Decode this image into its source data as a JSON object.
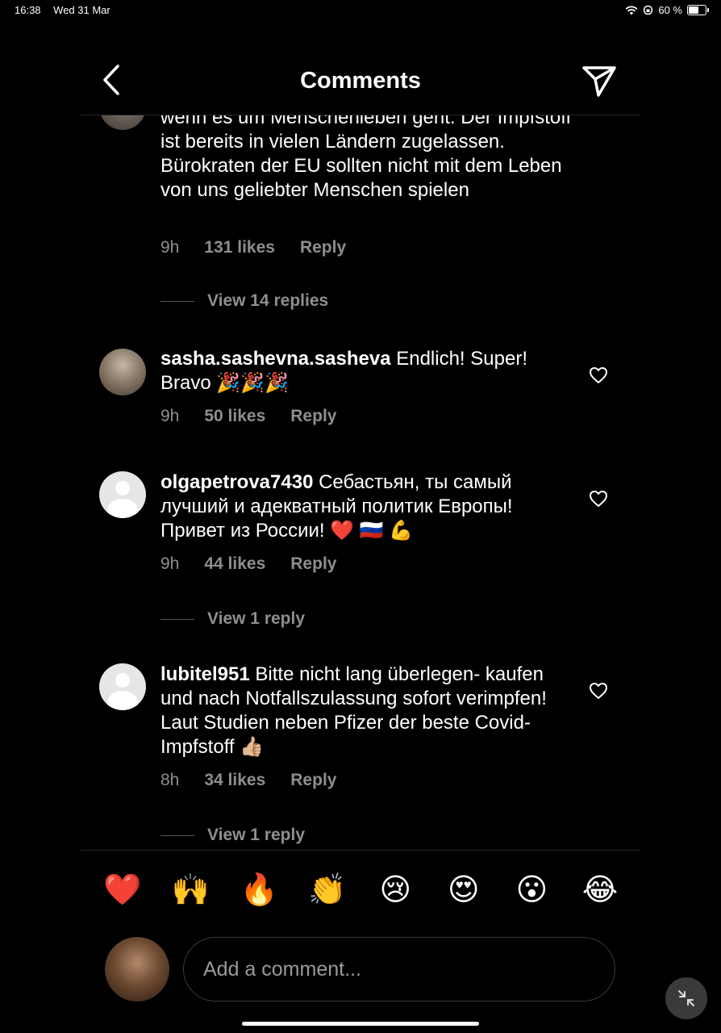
{
  "status_bar": {
    "time": "16:38",
    "date": "Wed 31 Mar",
    "battery": "60 %"
  },
  "header": {
    "title": "Comments"
  },
  "comments": [
    {
      "username": "",
      "text": "wenn es um Menschenleben geht. Der Impfstoff ist bereits in vielen Ländern zugelassen. Bürokraten der EU sollten nicht mit dem Leben von uns geliebter Menschen spielen",
      "time": "9h",
      "likes": "131 likes",
      "reply": "Reply",
      "view_replies": "View 14 replies"
    },
    {
      "username": "sasha.sashevna.sasheva",
      "text": "Endlich! Super! Bravo 🎉🎉🎉",
      "time": "9h",
      "likes": "50 likes",
      "reply": "Reply"
    },
    {
      "username": "olgapetrova7430",
      "text": "Себастьян, ты самый лучший и адекватный политик Европы! Привет из России! ❤️ 🇷🇺 💪",
      "time": "9h",
      "likes": "44 likes",
      "reply": "Reply",
      "view_replies": "View 1 reply"
    },
    {
      "username": "lubitel951",
      "text": "Bitte nicht lang überlegen- kaufen und nach Notfallszulassung sofort verimpfen! Laut Studien neben Pfizer der beste Covid-Impfstoff 👍🏼",
      "time": "8h",
      "likes": "34 likes",
      "reply": "Reply",
      "view_replies": "View 1 reply"
    }
  ],
  "emoji_bar": [
    "❤️",
    "🙌",
    "🔥",
    "👏",
    "😢",
    "😍",
    "😮",
    "😂"
  ],
  "composer": {
    "placeholder": "Add a comment..."
  }
}
